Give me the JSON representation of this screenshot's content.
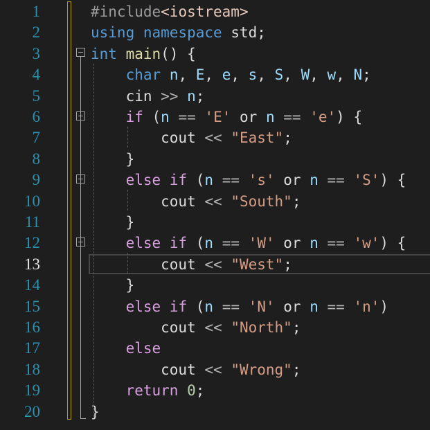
{
  "editor": {
    "current_line": 13,
    "lines": [
      {
        "n": "1",
        "tokens": [
          [
            "pp",
            "#include"
          ],
          [
            "inc",
            "<iostream>"
          ]
        ]
      },
      {
        "n": "2",
        "tokens": [
          [
            "kw",
            "using"
          ],
          [
            "plain",
            " "
          ],
          [
            "kw",
            "namespace"
          ],
          [
            "plain",
            " std;"
          ]
        ]
      },
      {
        "n": "3",
        "tokens": [
          [
            "kw",
            "int"
          ],
          [
            "plain",
            " "
          ],
          [
            "fn",
            "main"
          ],
          [
            "plain",
            "() {"
          ]
        ]
      },
      {
        "n": "4",
        "tokens": [
          [
            "plain",
            "    "
          ],
          [
            "kw",
            "char"
          ],
          [
            "plain",
            " "
          ],
          [
            "id",
            "n"
          ],
          [
            "plain",
            ", "
          ],
          [
            "id",
            "E"
          ],
          [
            "plain",
            ", "
          ],
          [
            "id",
            "e"
          ],
          [
            "plain",
            ", "
          ],
          [
            "id",
            "s"
          ],
          [
            "plain",
            ", "
          ],
          [
            "id",
            "S"
          ],
          [
            "plain",
            ", "
          ],
          [
            "id",
            "W"
          ],
          [
            "plain",
            ", "
          ],
          [
            "id",
            "w"
          ],
          [
            "plain",
            ", "
          ],
          [
            "id",
            "N"
          ],
          [
            "plain",
            ";"
          ]
        ]
      },
      {
        "n": "5",
        "tokens": [
          [
            "plain",
            "    cin "
          ],
          [
            "op",
            ">>"
          ],
          [
            "plain",
            " "
          ],
          [
            "id",
            "n"
          ],
          [
            "plain",
            ";"
          ]
        ]
      },
      {
        "n": "6",
        "tokens": [
          [
            "plain",
            "    "
          ],
          [
            "ctrl",
            "if"
          ],
          [
            "plain",
            " ("
          ],
          [
            "id",
            "n"
          ],
          [
            "plain",
            " "
          ],
          [
            "op",
            "=="
          ],
          [
            "plain",
            " "
          ],
          [
            "str",
            "'E'"
          ],
          [
            "plain",
            " or "
          ],
          [
            "id",
            "n"
          ],
          [
            "plain",
            " "
          ],
          [
            "op",
            "=="
          ],
          [
            "plain",
            " "
          ],
          [
            "str",
            "'e'"
          ],
          [
            "plain",
            ") {"
          ]
        ]
      },
      {
        "n": "7",
        "tokens": [
          [
            "plain",
            "        cout "
          ],
          [
            "op",
            "<<"
          ],
          [
            "plain",
            " "
          ],
          [
            "str",
            "\"East\""
          ],
          [
            "plain",
            ";"
          ]
        ]
      },
      {
        "n": "8",
        "tokens": [
          [
            "plain",
            "    }"
          ]
        ]
      },
      {
        "n": "9",
        "tokens": [
          [
            "plain",
            "    "
          ],
          [
            "ctrl",
            "else"
          ],
          [
            "plain",
            " "
          ],
          [
            "ctrl",
            "if"
          ],
          [
            "plain",
            " ("
          ],
          [
            "id",
            "n"
          ],
          [
            "plain",
            " "
          ],
          [
            "op",
            "=="
          ],
          [
            "plain",
            " "
          ],
          [
            "str",
            "'s'"
          ],
          [
            "plain",
            " or "
          ],
          [
            "id",
            "n"
          ],
          [
            "plain",
            " "
          ],
          [
            "op",
            "=="
          ],
          [
            "plain",
            " "
          ],
          [
            "str",
            "'S'"
          ],
          [
            "plain",
            ") {"
          ]
        ]
      },
      {
        "n": "10",
        "tokens": [
          [
            "plain",
            "        cout "
          ],
          [
            "op",
            "<<"
          ],
          [
            "plain",
            " "
          ],
          [
            "str",
            "\"South\""
          ],
          [
            "plain",
            ";"
          ]
        ]
      },
      {
        "n": "11",
        "tokens": [
          [
            "plain",
            "    }"
          ]
        ]
      },
      {
        "n": "12",
        "tokens": [
          [
            "plain",
            "    "
          ],
          [
            "ctrl",
            "else"
          ],
          [
            "plain",
            " "
          ],
          [
            "ctrl",
            "if"
          ],
          [
            "plain",
            " ("
          ],
          [
            "id",
            "n"
          ],
          [
            "plain",
            " "
          ],
          [
            "op",
            "=="
          ],
          [
            "plain",
            " "
          ],
          [
            "str",
            "'W'"
          ],
          [
            "plain",
            " or "
          ],
          [
            "id",
            "n"
          ],
          [
            "plain",
            " "
          ],
          [
            "op",
            "=="
          ],
          [
            "plain",
            " "
          ],
          [
            "str",
            "'w'"
          ],
          [
            "plain",
            ") {"
          ]
        ]
      },
      {
        "n": "13",
        "tokens": [
          [
            "plain",
            "        cout "
          ],
          [
            "op",
            "<<"
          ],
          [
            "plain",
            " "
          ],
          [
            "str",
            "\"West\""
          ],
          [
            "plain",
            ";"
          ]
        ]
      },
      {
        "n": "14",
        "tokens": [
          [
            "plain",
            "    }"
          ]
        ]
      },
      {
        "n": "15",
        "tokens": [
          [
            "plain",
            "    "
          ],
          [
            "ctrl",
            "else"
          ],
          [
            "plain",
            " "
          ],
          [
            "ctrl",
            "if"
          ],
          [
            "plain",
            " ("
          ],
          [
            "id",
            "n"
          ],
          [
            "plain",
            " "
          ],
          [
            "op",
            "=="
          ],
          [
            "plain",
            " "
          ],
          [
            "str",
            "'N'"
          ],
          [
            "plain",
            " or "
          ],
          [
            "id",
            "n"
          ],
          [
            "plain",
            " "
          ],
          [
            "op",
            "=="
          ],
          [
            "plain",
            " "
          ],
          [
            "str",
            "'n'"
          ],
          [
            "plain",
            ")"
          ]
        ]
      },
      {
        "n": "16",
        "tokens": [
          [
            "plain",
            "        cout "
          ],
          [
            "op",
            "<<"
          ],
          [
            "plain",
            " "
          ],
          [
            "str",
            "\"North\""
          ],
          [
            "plain",
            ";"
          ]
        ]
      },
      {
        "n": "17",
        "tokens": [
          [
            "plain",
            "    "
          ],
          [
            "ctrl",
            "else"
          ]
        ]
      },
      {
        "n": "18",
        "tokens": [
          [
            "plain",
            "        cout "
          ],
          [
            "op",
            "<<"
          ],
          [
            "plain",
            " "
          ],
          [
            "str",
            "\"Wrong\""
          ],
          [
            "plain",
            ";"
          ]
        ]
      },
      {
        "n": "19",
        "tokens": [
          [
            "plain",
            "    "
          ],
          [
            "ctrl",
            "return"
          ],
          [
            "plain",
            " "
          ],
          [
            "num",
            "0"
          ],
          [
            "plain",
            ";"
          ]
        ]
      },
      {
        "n": "20",
        "tokens": [
          [
            "plain",
            "}"
          ]
        ]
      }
    ]
  }
}
